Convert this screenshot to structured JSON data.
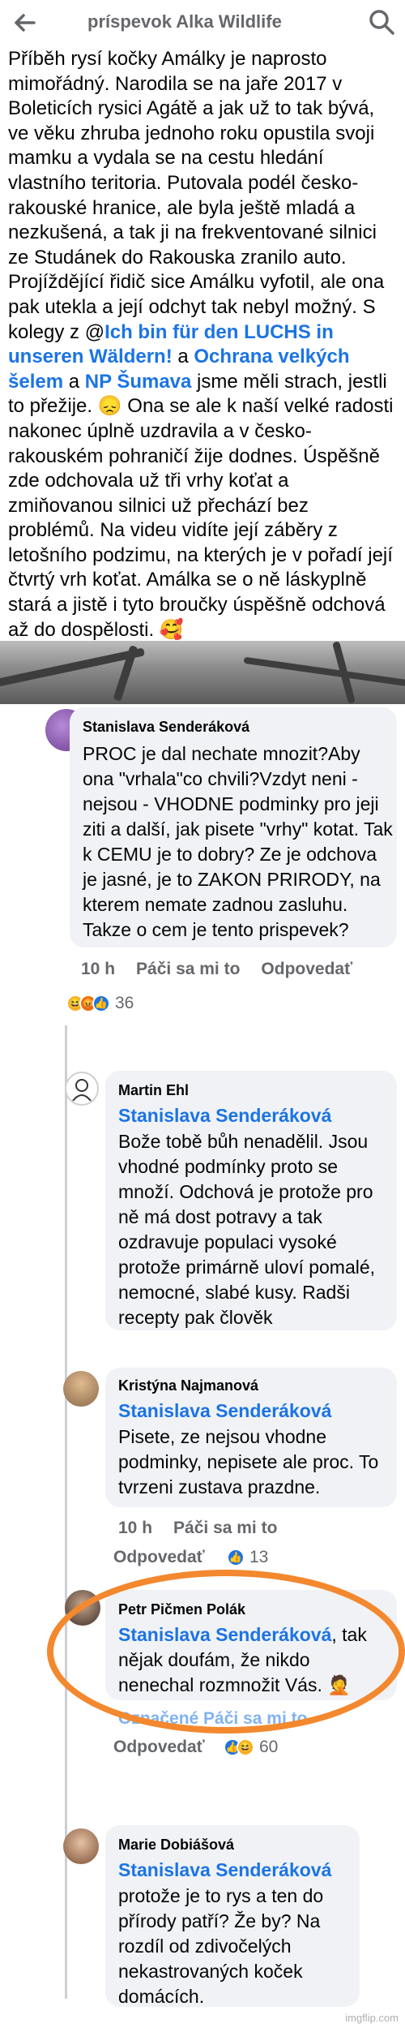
{
  "header": {
    "title": "príspevok Alka Wildlife"
  },
  "post": {
    "text_before_links": "Příběh rysí kočky Amálky je naprosto mimořádný. Narodila se na jaře 2017 v Boleticích rysici Agátě a jak už to tak bývá, ve věku zhruba jednoho roku opustila svoji mamku a vydala se na cestu hledání vlastního teritoria. Putovala podél česko-rakouské hranice, ale byla ještě mladá a nezkušená, a tak ji na frekventované silnici ze Studánek do Rakouska zranilo auto. Projíždějící řidič sice Amálku vyfotil, ale ona pak utekla a její odchyt tak nebyl možný. S kolegy z @",
    "link1": "Ich bin für den LUCHS in unseren Wäldern!",
    "join1": " a ",
    "link2": "Ochrana velkých šelem",
    "join2": " a ",
    "link3": "NP Šumava",
    "text_after_links": " jsme měli strach, jestli to přežije. 😞 Ona se ale k naší velké radosti nakonec úplně uzdravila a v česko-rakouském pohraničí žije dodnes. Úspěšně zde odchovala už tři vrhy koťat a zmiňovanou silnici už přechází bez problémů. Na videu vidíte její záběry z letošního podzimu, na kterých je v pořadí její čtvrtý vrh koťat. Amálka se o ně láskyplně stará a jistě i tyto broučky úspěšně odchová až do dospělosti. 🥰"
  },
  "comments": [
    {
      "name": "Stanislava Senderáková",
      "mention": "",
      "text": "PROC je dal nechate mnozit?Aby ona \"vrhala\"co  chvili?Vzdyt neni - nejsou - VHODNE podminky pro jeji ziti a další, jak pisete \"vrhy\" kotat. Tak k CEMU je to dobry? Ze je odchova je jasné, je to ZAKON PRIRODY, na kterem nemate zadnou zasluhu. Takze o cem je tento prispevek?",
      "time": "10 h",
      "like": "Páči sa mi to",
      "reply": "Odpovedať",
      "react_count": "36"
    },
    {
      "name": "Martin Ehl",
      "mention": "Stanislava Senderáková",
      "text": "Bože tobě bůh nenadělil. Jsou vhodné podmínky proto se množí. Odchová je protože pro ně má dost potravy a tak ozdravuje populaci vysoké protože primárně uloví pomalé, nemocné, slabé kusy. Radši recepty pak člověk"
    },
    {
      "name": "Kristýna Najmanová",
      "mention": "Stanislava Senderáková",
      "text": "Pisete, ze nejsou vhodne podminky, nepisete ale proc. To tvrzeni zustava prazdne.",
      "time": "10 h",
      "like": "Páči sa mi to",
      "reply": "Odpovedať",
      "react_count": "13"
    },
    {
      "name": "Petr Pičmen Polák",
      "mention": "Stanislava Senderáková",
      "text": ", tak nějak doufám, že nikdo nenechal rozmnožit Vás. 🤦",
      "meta_partial": "Označené  Páči sa mi to",
      "reply": "Odpovedať",
      "react_count": "60"
    },
    {
      "name": "Marie Dobiášová",
      "mention": "Stanislava Senderáková",
      "text": "protože je to rys a ten do přírody patří? Že by? Na rozdíl od zdivočelých nekastrovaných koček domácích."
    }
  ],
  "watermark": "imgflip.com",
  "colors": {
    "link": "#1b74e4",
    "bubble": "#f0f2f5",
    "highlight": "#f3882e"
  }
}
